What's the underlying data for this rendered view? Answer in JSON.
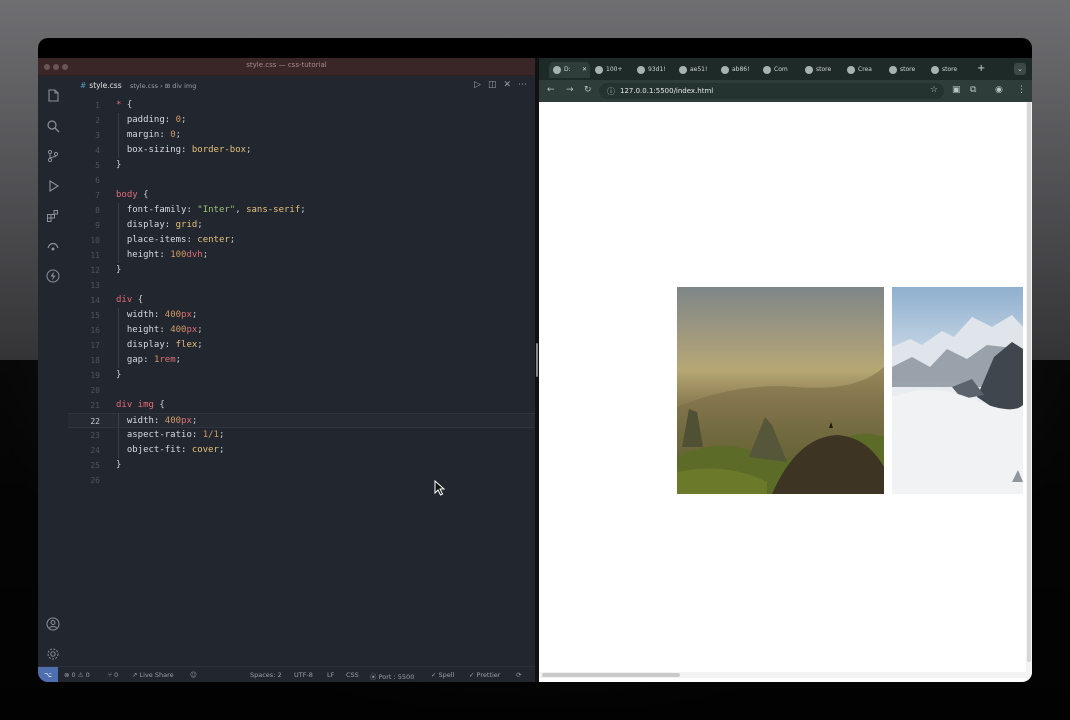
{
  "vscode": {
    "window_title": "style.css — css-tutorial",
    "tab": {
      "filename": "style.css",
      "lang_icon": "#",
      "breadcrumb": "style.css › ⊞ div img"
    },
    "lines": [
      {
        "n": "1",
        "tokens": [
          [
            "sel",
            "* "
          ],
          [
            "brace",
            "{"
          ]
        ]
      },
      {
        "n": "2",
        "tokens": [
          [
            "prop",
            "  padding: "
          ],
          [
            "val",
            "0"
          ],
          [
            "brace",
            ";"
          ]
        ]
      },
      {
        "n": "3",
        "tokens": [
          [
            "prop",
            "  margin: "
          ],
          [
            "val",
            "0"
          ],
          [
            "brace",
            ";"
          ]
        ]
      },
      {
        "n": "4",
        "tokens": [
          [
            "prop",
            "  box-sizing: "
          ],
          [
            "kw",
            "border-box"
          ],
          [
            "brace",
            ";"
          ]
        ]
      },
      {
        "n": "5",
        "tokens": [
          [
            "brace",
            "}"
          ]
        ]
      },
      {
        "n": "6",
        "tokens": []
      },
      {
        "n": "7",
        "tokens": [
          [
            "sel",
            "body "
          ],
          [
            "brace",
            "{"
          ]
        ]
      },
      {
        "n": "8",
        "tokens": [
          [
            "prop",
            "  font-family: "
          ],
          [
            "str",
            "\"Inter\""
          ],
          [
            "brace",
            ", "
          ],
          [
            "kw",
            "sans-serif"
          ],
          [
            "brace",
            ";"
          ]
        ]
      },
      {
        "n": "9",
        "tokens": [
          [
            "prop",
            "  display: "
          ],
          [
            "kw",
            "grid"
          ],
          [
            "brace",
            ";"
          ]
        ]
      },
      {
        "n": "10",
        "tokens": [
          [
            "prop",
            "  place-items: "
          ],
          [
            "kw",
            "center"
          ],
          [
            "brace",
            ";"
          ]
        ]
      },
      {
        "n": "11",
        "tokens": [
          [
            "prop",
            "  height: "
          ],
          [
            "val",
            "100"
          ],
          [
            "unit",
            "dvh"
          ],
          [
            "brace",
            ";"
          ]
        ]
      },
      {
        "n": "12",
        "tokens": [
          [
            "brace",
            "}"
          ]
        ]
      },
      {
        "n": "13",
        "tokens": []
      },
      {
        "n": "14",
        "tokens": [
          [
            "sel",
            "div "
          ],
          [
            "brace",
            "{"
          ]
        ]
      },
      {
        "n": "15",
        "tokens": [
          [
            "prop",
            "  width: "
          ],
          [
            "val",
            "400"
          ],
          [
            "unit",
            "px"
          ],
          [
            "brace",
            ";"
          ]
        ]
      },
      {
        "n": "16",
        "tokens": [
          [
            "prop",
            "  height: "
          ],
          [
            "val",
            "400"
          ],
          [
            "unit",
            "px"
          ],
          [
            "brace",
            ";"
          ]
        ]
      },
      {
        "n": "17",
        "tokens": [
          [
            "prop",
            "  display: "
          ],
          [
            "kw",
            "flex"
          ],
          [
            "brace",
            ";"
          ]
        ]
      },
      {
        "n": "18",
        "tokens": [
          [
            "prop",
            "  gap: "
          ],
          [
            "val",
            "1"
          ],
          [
            "unit",
            "rem"
          ],
          [
            "brace",
            ";"
          ]
        ]
      },
      {
        "n": "19",
        "tokens": [
          [
            "brace",
            "}"
          ]
        ]
      },
      {
        "n": "20",
        "tokens": []
      },
      {
        "n": "21",
        "tokens": [
          [
            "sel",
            "div img "
          ],
          [
            "brace",
            "{"
          ]
        ]
      },
      {
        "n": "22",
        "tokens": [
          [
            "prop",
            "  width: "
          ],
          [
            "val",
            "400"
          ],
          [
            "unit",
            "px"
          ],
          [
            "brace",
            ";"
          ]
        ],
        "active": true
      },
      {
        "n": "23",
        "tokens": [
          [
            "prop",
            "  aspect-ratio: "
          ],
          [
            "val",
            "1/1"
          ],
          [
            "brace",
            ";"
          ]
        ]
      },
      {
        "n": "24",
        "tokens": [
          [
            "prop",
            "  object-fit: "
          ],
          [
            "kw",
            "cover"
          ],
          [
            "brace",
            ";"
          ]
        ]
      },
      {
        "n": "25",
        "tokens": [
          [
            "brace",
            "}"
          ]
        ]
      },
      {
        "n": "26",
        "tokens": []
      }
    ],
    "status": {
      "errors": "⊗ 0 ⚠ 0",
      "ports": "⑂ 0",
      "live_share": "Live Share",
      "spaces": "Spaces: 2",
      "encoding": "UTF-8",
      "eol": "LF",
      "language": "CSS",
      "port": "Port : 5500",
      "spell": "Spell",
      "prettier": "Prettier"
    }
  },
  "chrome": {
    "tabs": [
      {
        "label": "D:",
        "active": true
      },
      {
        "label": "100+"
      },
      {
        "label": "93d1!"
      },
      {
        "label": "ae51!"
      },
      {
        "label": "ab86!"
      },
      {
        "label": "Com"
      },
      {
        "label": "store"
      },
      {
        "label": "Crea"
      },
      {
        "label": "store"
      },
      {
        "label": "store"
      }
    ],
    "url": "127.0.0.1:5500/index.html"
  }
}
